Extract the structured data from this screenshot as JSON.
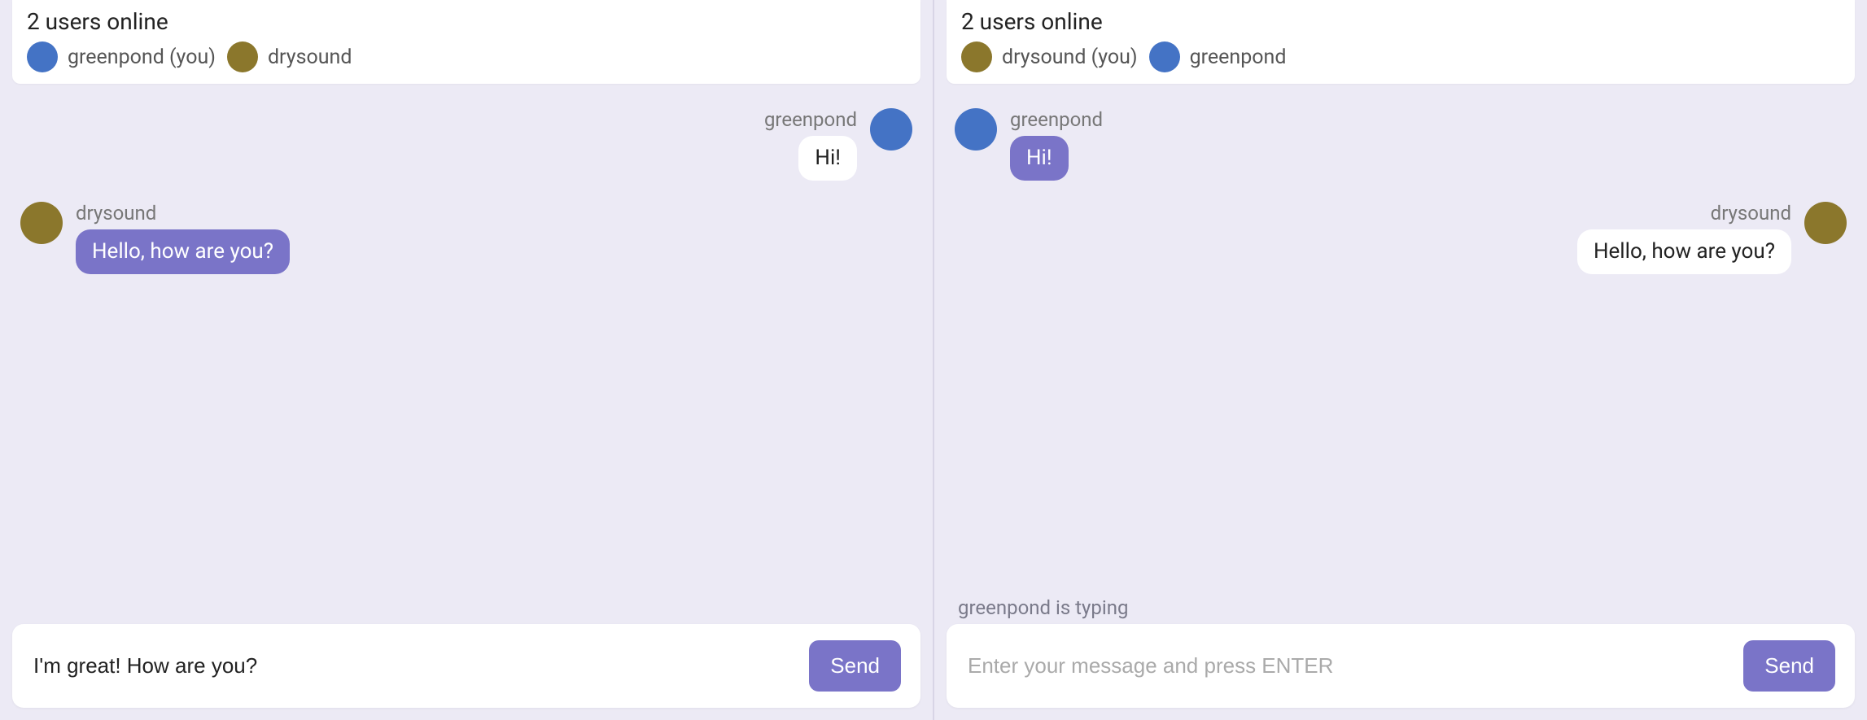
{
  "colors": {
    "greenpond": "#4473c5",
    "drysound": "#8b772c",
    "accent": "#7a74c8"
  },
  "left": {
    "header": {
      "title": "2 users online",
      "users": [
        {
          "name": "greenpond (you)",
          "color": "greenpond"
        },
        {
          "name": "drysound",
          "color": "drysound"
        }
      ]
    },
    "messages": [
      {
        "sender": "greenpond",
        "color": "greenpond",
        "text": "Hi!",
        "outgoing": true,
        "bubble": "white"
      },
      {
        "sender": "drysound",
        "color": "drysound",
        "text": "Hello, how are you?",
        "outgoing": false,
        "bubble": "purple"
      }
    ],
    "typing": "",
    "composer": {
      "value": "I'm great! How are you?",
      "placeholder": "Enter your message and press ENTER",
      "send_label": "Send"
    }
  },
  "right": {
    "header": {
      "title": "2 users online",
      "users": [
        {
          "name": "drysound (you)",
          "color": "drysound"
        },
        {
          "name": "greenpond",
          "color": "greenpond"
        }
      ]
    },
    "messages": [
      {
        "sender": "greenpond",
        "color": "greenpond",
        "text": "Hi!",
        "outgoing": false,
        "bubble": "purple"
      },
      {
        "sender": "drysound",
        "color": "drysound",
        "text": "Hello, how are you?",
        "outgoing": true,
        "bubble": "white"
      }
    ],
    "typing": "greenpond is typing",
    "composer": {
      "value": "",
      "placeholder": "Enter your message and press ENTER",
      "send_label": "Send"
    }
  }
}
